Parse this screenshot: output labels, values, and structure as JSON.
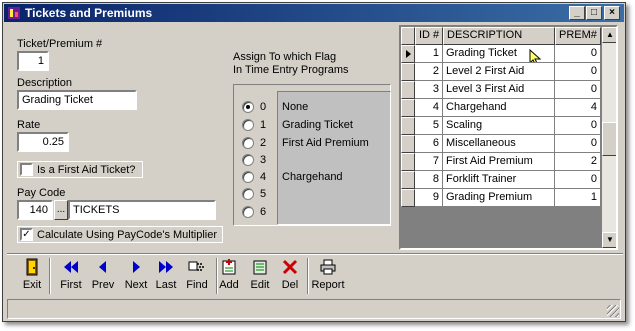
{
  "window": {
    "title": "Tickets and Premiums"
  },
  "form": {
    "ticket_label": "Ticket/Premium #",
    "ticket_value": "1",
    "description_label": "Description",
    "description_value": "Grading Ticket",
    "rate_label": "Rate",
    "rate_value": "0.25",
    "first_aid_label": "Is a First Aid Ticket?",
    "first_aid_checked": false,
    "paycode_label": "Pay Code",
    "paycode_value": "140",
    "paycode_button": "...",
    "paycode_name": "TICKETS",
    "multiplier_label": "Calculate Using PayCode's Multiplier",
    "multiplier_checked": true
  },
  "flags": {
    "title_line1": "Assign To which Flag",
    "title_line2": "In Time Entry Programs",
    "selected": 0,
    "items": [
      {
        "num": "0",
        "name": "None"
      },
      {
        "num": "1",
        "name": "Grading Ticket"
      },
      {
        "num": "2",
        "name": "First Aid Premium"
      },
      {
        "num": "3",
        "name": ""
      },
      {
        "num": "4",
        "name": "Chargehand"
      },
      {
        "num": "5",
        "name": ""
      },
      {
        "num": "6",
        "name": ""
      }
    ]
  },
  "grid": {
    "headers": [
      "ID #",
      "DESCRIPTION",
      "PREM#"
    ],
    "rows": [
      {
        "id": "1",
        "desc": "Grading Ticket",
        "prem": "0"
      },
      {
        "id": "2",
        "desc": "Level 2 First Aid",
        "prem": "0"
      },
      {
        "id": "3",
        "desc": "Level 3 First Aid",
        "prem": "0"
      },
      {
        "id": "4",
        "desc": "Chargehand",
        "prem": "4"
      },
      {
        "id": "5",
        "desc": "Scaling",
        "prem": "0"
      },
      {
        "id": "6",
        "desc": "Miscellaneous",
        "prem": "0"
      },
      {
        "id": "7",
        "desc": "First Aid Premium",
        "prem": "2"
      },
      {
        "id": "8",
        "desc": "Forklift Trainer",
        "prem": "0"
      },
      {
        "id": "9",
        "desc": "Grading Premium",
        "prem": "1"
      }
    ]
  },
  "toolbar": {
    "exit": "Exit",
    "first": "First",
    "prev": "Prev",
    "next": "Next",
    "last": "Last",
    "find": "Find",
    "add": "Add",
    "edit": "Edit",
    "del": "Del",
    "report": "Report"
  },
  "colors": {
    "titlebar_start": "#0a246a",
    "nav_blue": "#0000cc",
    "delete_red": "#cc0000"
  }
}
